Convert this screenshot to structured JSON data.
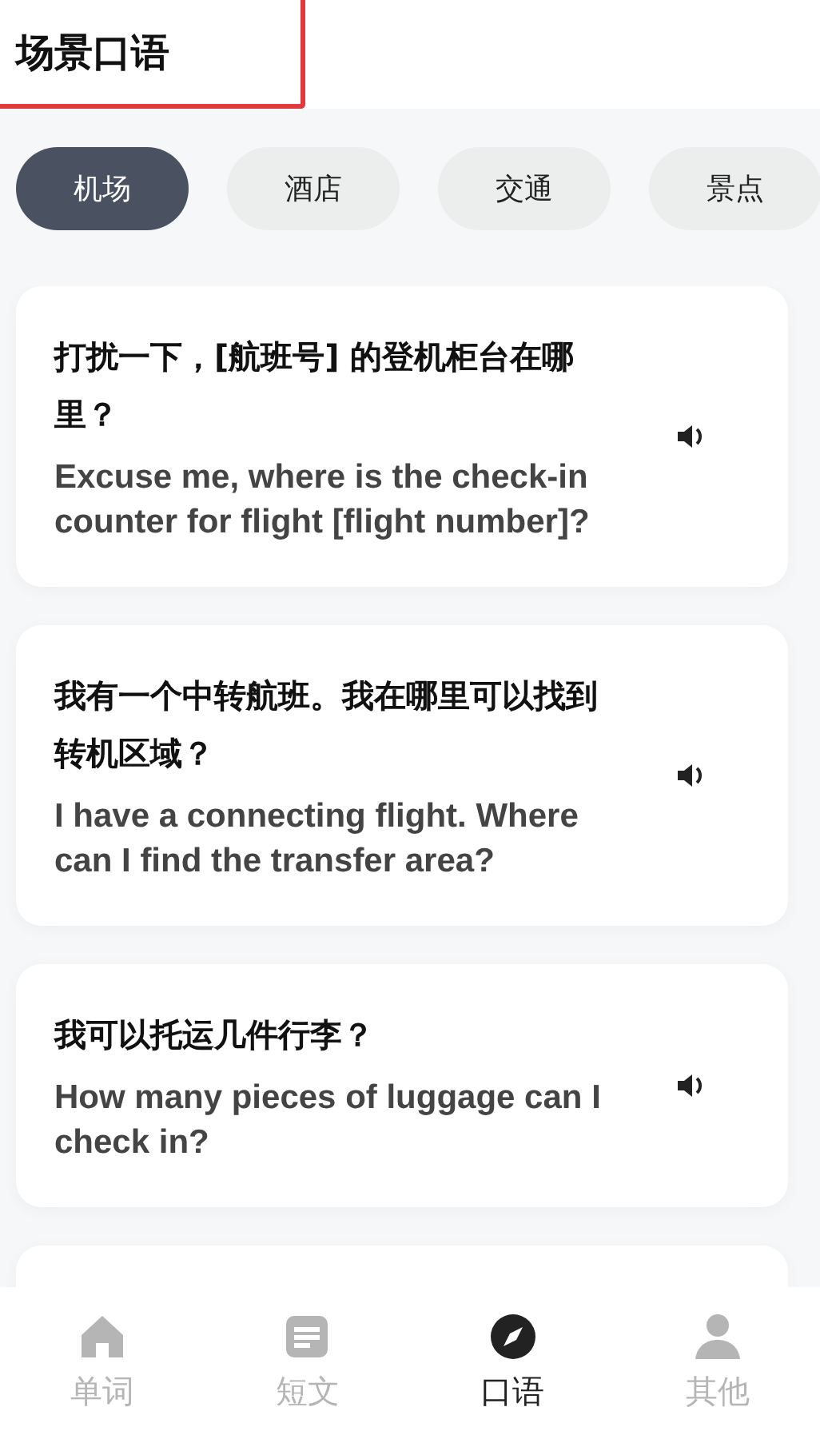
{
  "header": {
    "title": "场景口语"
  },
  "categories": [
    {
      "label": "机场",
      "selected": true
    },
    {
      "label": "酒店",
      "selected": false
    },
    {
      "label": "交通",
      "selected": false
    },
    {
      "label": "景点",
      "selected": false
    }
  ],
  "phrases": [
    {
      "chinese": "打扰一下，[航班号] 的登机柜台在哪里？",
      "english": "Excuse me, where is the check-in counter for flight [flight number]?"
    },
    {
      "chinese": "我有一个中转航班。我在哪里可以找到转机区域？",
      "english": "I have a connecting flight. Where can I find the transfer area?"
    },
    {
      "chinese": "我可以托运几件行李？",
      "english": "How many pieces of luggage can I check in?"
    }
  ],
  "nav": [
    {
      "label": "单词",
      "kind": "home",
      "selected": false
    },
    {
      "label": "短文",
      "kind": "article",
      "selected": false
    },
    {
      "label": "口语",
      "kind": "compass",
      "selected": true
    },
    {
      "label": "其他",
      "kind": "person",
      "selected": false
    }
  ]
}
